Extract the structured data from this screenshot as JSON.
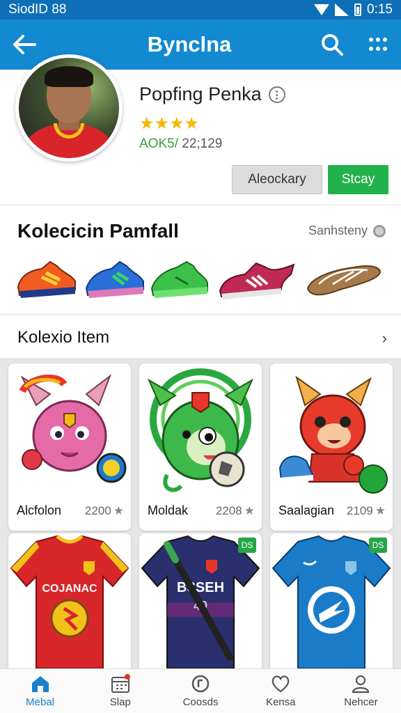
{
  "status_bar": {
    "left_text": "SiodID 88",
    "time": "0:15"
  },
  "app_bar": {
    "title": "Byncl­na"
  },
  "profile": {
    "name": "Popfing Penka",
    "stars": "★★★★",
    "stats_green": "AOK5/",
    "stats_grey": " 22;129",
    "button_secondary": "Aleockary",
    "button_primary": "Stcay"
  },
  "collection": {
    "title": "Kolecicin Pamfall",
    "side_label": "Sanhsteny",
    "shoes": [
      "orange-sneaker",
      "blue-sneaker",
      "green-sneaker",
      "red-sneaker",
      "brown-sandal"
    ]
  },
  "items_section": {
    "title": "Kolexio Item",
    "chevron": "›"
  },
  "items": [
    {
      "name": "Alcfolon",
      "points": "2200",
      "badge": ""
    },
    {
      "name": "Moldak",
      "points": "2208",
      "badge": ""
    },
    {
      "name": "Saalagian",
      "points": "2109",
      "badge": ""
    },
    {
      "name": "",
      "points": "",
      "badge": ""
    },
    {
      "name": "",
      "points": "",
      "badge": "DS"
    },
    {
      "name": "",
      "points": "",
      "badge": "DS"
    }
  ],
  "bottom_nav": [
    {
      "label": "Mebal",
      "icon": "home-icon",
      "active": true
    },
    {
      "label": "Slap",
      "icon": "calendar-icon",
      "active": false
    },
    {
      "label": "Coosds",
      "icon": "coin-icon",
      "active": false
    },
    {
      "label": "Kensa",
      "icon": "heart-icon",
      "active": false
    },
    {
      "label": "Nehcer",
      "icon": "person-icon",
      "active": false
    }
  ],
  "colors": {
    "primary": "#1289d0",
    "accent_green": "#22b24c",
    "star": "#f5b800"
  }
}
